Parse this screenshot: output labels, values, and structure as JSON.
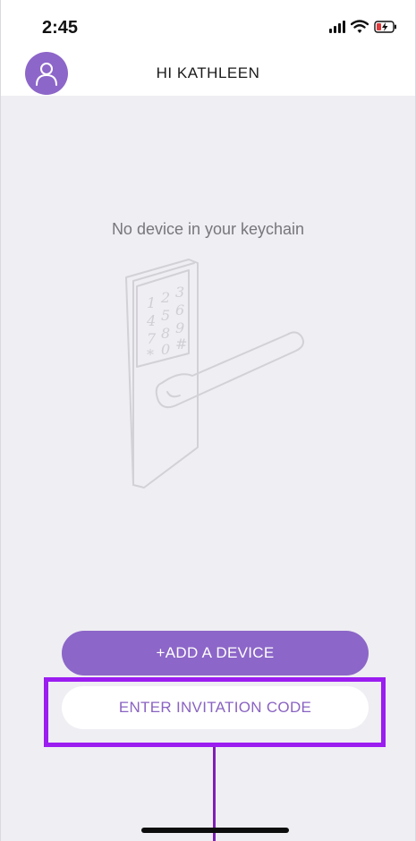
{
  "status_bar": {
    "time": "2:45",
    "icons": [
      "signal-icon",
      "wifi-icon",
      "battery-charging-icon"
    ]
  },
  "header": {
    "greeting": "HI KATHLEEN",
    "avatar_icon": "user-icon"
  },
  "main": {
    "empty_message": "No device in your keychain",
    "illustration": "door-lock-illustration",
    "keypad": [
      "1",
      "2",
      "3",
      "4",
      "5",
      "6",
      "7",
      "8",
      "9",
      "*",
      "0",
      "#"
    ]
  },
  "actions": {
    "add_device_label": "+ADD A DEVICE",
    "invitation_label": "ENTER INVITATION CODE"
  },
  "colors": {
    "accent": "#8c66c8",
    "highlight": "#9b1df0",
    "background": "#efeef3"
  }
}
